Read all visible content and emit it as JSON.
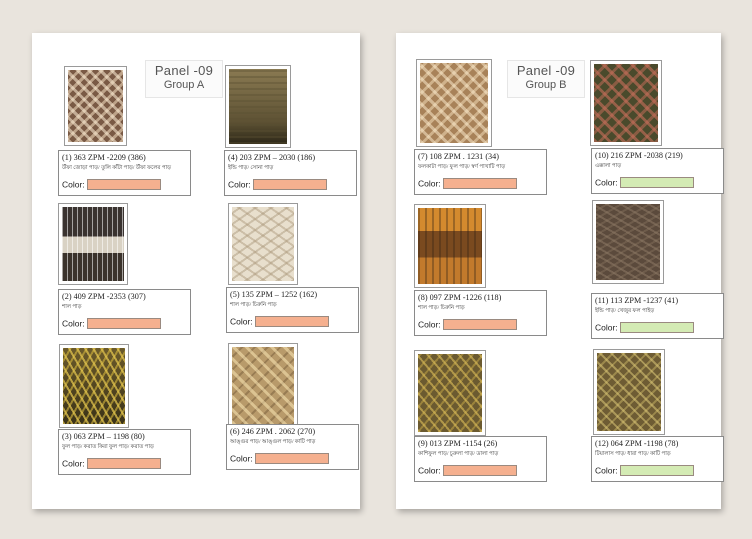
{
  "sheets": [
    {
      "panel_title": "Panel -09",
      "group": "Group A",
      "items": [
        {
          "id": "(1) 363 ZPM -2209 (386)",
          "desc": "উঁফা জোড়া পাড়/ তুলি কাঁটা পাড়/ উঁফা ফলের পাড়",
          "color_label": "Color:",
          "swatch": "#f5b08f"
        },
        {
          "id": "(4) 203 ZPM – 2030 (186)",
          "desc": "ইন্ডি পাড়/ সোনা পাড়",
          "color_label": "Color:",
          "swatch": "#f5b08f"
        },
        {
          "id": "(2) 409 ZPM -2353 (307)",
          "desc": "শাল পাড়",
          "color_label": "Color:",
          "swatch": "#f5b08f"
        },
        {
          "id": "(5) 135 ZPM – 1252 (162)",
          "desc": "শাল পাড়/ চিরুনি পাড়",
          "color_label": "Color:",
          "swatch": "#f5b08f"
        },
        {
          "id": "(3) 063 ZPM – 1198 (80)",
          "desc": "ফুল পাড়/ করাত কিরা ফুল পাড়/ করাত পাড়",
          "color_label": "Color:",
          "swatch": "#f5b08f"
        },
        {
          "id": "(6) 246 ZPM . 2062 (270)",
          "desc": "আঙ্গুর পাড়/ আঙ্গুল পাড়/ কাটি পাড়",
          "color_label": "Color:",
          "swatch": "#f5b08f"
        }
      ]
    },
    {
      "panel_title": "Panel -09",
      "group": "Group B",
      "items": [
        {
          "id": "(7) 108 ZPM . 1231 (34)",
          "desc": "ফলকাটা পাড়/ ফুল পাড়/ স্বর্ণ পাখাটি পাড়",
          "color_label": "Color:",
          "swatch": "#f5b08f"
        },
        {
          "id": "(10) 216 ZPM -2038 (219)",
          "desc": "এক্কালা পাড়",
          "color_label": "Color:",
          "swatch": "#d4ebb4"
        },
        {
          "id": "(8) 097 ZPM -1226 (118)",
          "desc": "শাল পাড়/ চিরুনি পাড়",
          "color_label": "Color:",
          "swatch": "#f5b08f"
        },
        {
          "id": "(11) 113 ZPM -1237 (41)",
          "desc": "ইন্ডি পাড়/ খেজুর ফল পাইড়",
          "color_label": "Color:",
          "swatch": "#d4ebb4"
        },
        {
          "id": "(9) 013 ZPM -1154 (26)",
          "desc": "কাশিফুল পাড়/ চুরুলা পাড়/ ডালা পাড়",
          "color_label": "Color:",
          "swatch": "#f5b08f"
        },
        {
          "id": "(12) 064 ZPM -1198 (78)",
          "desc": "টিয়ালাস পাড়/ ধারা পাড়/ কাটি পাড়",
          "color_label": "Color:",
          "swatch": "#d4ebb4"
        }
      ]
    }
  ]
}
